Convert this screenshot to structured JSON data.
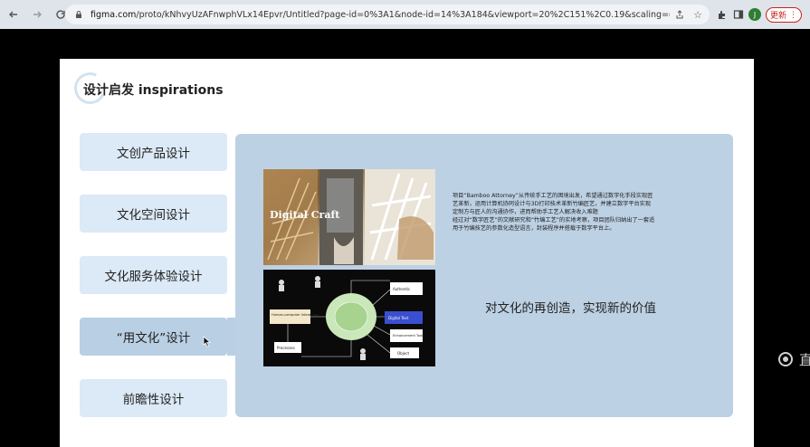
{
  "browser": {
    "url_host": "figma.com",
    "url_path": "/proto/kNhvyUzAFnwphVLx14Epvr/Untitled?page-id=0%3A1&node-id=14%3A184&viewport=20%2C151%2C0.19&scaling=contain&starting-point-...",
    "avatar_letter": "J",
    "update_label": "更新",
    "icons": [
      "back-icon",
      "forward-icon",
      "reload-icon",
      "lock-icon",
      "share-icon",
      "bookmark-star-icon",
      "extensions-icon",
      "sidebar-icon",
      "more-icon"
    ]
  },
  "slide": {
    "title": "设计启发 inspirations",
    "menu": [
      {
        "label": "文创产品设计",
        "active": false
      },
      {
        "label": "文化空间设计",
        "active": false
      },
      {
        "label": "文化服务体验设计",
        "active": false
      },
      {
        "label": "“用文化”设计",
        "active": true
      },
      {
        "label": "前瞻性设计",
        "active": false
      }
    ],
    "image1_label": "Digital Craft",
    "diagram_labels": [
      "Human-computer Interaction",
      "Digital Text",
      "Authentic",
      "Processes",
      "Enhancement Tools",
      "Object"
    ],
    "description_lines": [
      "项目“Bamboo Attorney”从传统手工艺的困境出发，希望通过数字化手段实现匠",
      "艺革新，运用计算机协同设计与3D打印技术革新竹编匠艺，并建立数字平台实现",
      "定制方与匠人的沟通协作，进而帮助手工艺人解决收入难题",
      "经过对“数字匠艺”的文献研究和“竹编工艺”的实地考察，项目团队归纳出了一套适",
      "用于竹编技艺的参数化造型语言，封装程序并搭载于数字平台上。"
    ],
    "tagline": "对文化的再创造，实现新的价值"
  },
  "side": {
    "text": "直"
  },
  "colors": {
    "panel": "#bdd1e4",
    "menu": "#dce9f6",
    "menu_active": "#b9cfe3",
    "update": "#c5221f"
  }
}
